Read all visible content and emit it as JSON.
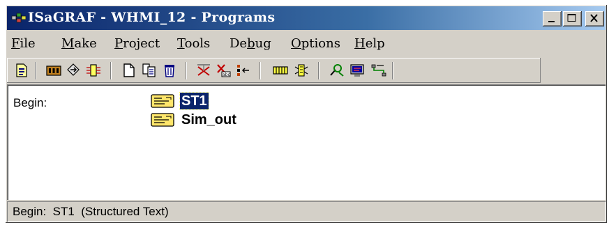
{
  "window": {
    "title": "ISaGRAF - WHMI_12 - Programs"
  },
  "caption_buttons": {
    "minimize": "_",
    "maximize": "□",
    "close": "×"
  },
  "menu": [
    {
      "label": "File",
      "mnemonic": "F",
      "rest": "ile"
    },
    {
      "label": "Make",
      "mnemonic": "M",
      "rest": "ake"
    },
    {
      "label": "Project",
      "mnemonic": "P",
      "rest": "roject"
    },
    {
      "label": "Tools",
      "mnemonic": "T",
      "rest": "ools"
    },
    {
      "label": "Debug",
      "pre": "De",
      "mnemonic": "b",
      "rest": "ug"
    },
    {
      "label": "Options",
      "mnemonic": "O",
      "rest": "ptions"
    },
    {
      "label": "Help",
      "mnemonic": "H",
      "rest": "elp"
    }
  ],
  "toolbar": [
    "properties-icon",
    "dictionary-icon",
    "link-icon",
    "io-connection-icon",
    "new-program-icon",
    "copy-icon",
    "delete-icon",
    "make-icon",
    "touch-icon",
    "verify-icon",
    "library-icon",
    "io-driver-icon",
    "debug-icon",
    "simulate-icon",
    "network-icon"
  ],
  "programs": {
    "section_label": "Begin:",
    "items": [
      {
        "name": "ST1",
        "selected": true
      },
      {
        "name": "Sim_out",
        "selected": false
      }
    ]
  },
  "status": {
    "text": "Begin:  ST1  (Structured Text)"
  },
  "colors": {
    "title_start": "#0a246a",
    "title_end": "#a6caf0",
    "face": "#d4d0c8",
    "selection": "#0a246a",
    "program_icon": "#ffe66b"
  }
}
